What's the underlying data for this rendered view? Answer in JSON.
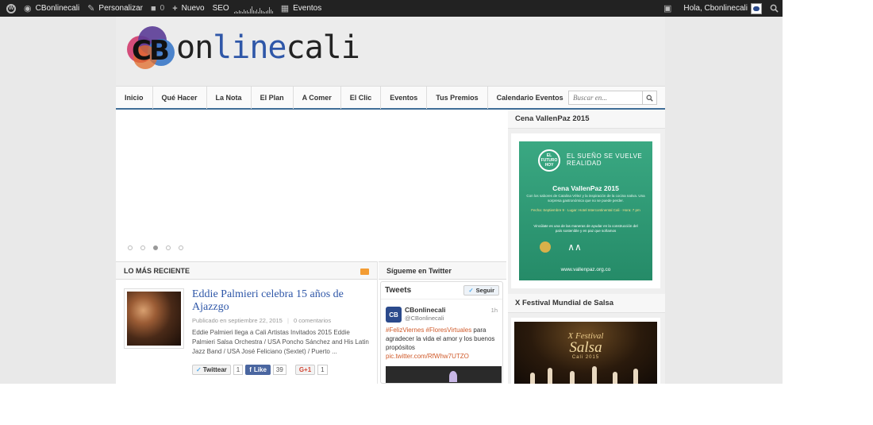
{
  "adminbar": {
    "site_name": "CBonlinecali",
    "customize": "Personalizar",
    "comments_count": "0",
    "new": "Nuevo",
    "seo": "SEO",
    "events": "Eventos",
    "greeting": "Hola, Cbonlinecali"
  },
  "header": {
    "logo_cb": "CB",
    "logo_part1": "on",
    "logo_part2": "line",
    "logo_part3": "cali"
  },
  "nav": {
    "items": [
      "Inicio",
      "Qué Hacer",
      "La Nota",
      "El Plan",
      "A Comer",
      "El Clic",
      "Eventos",
      "Tus Premios",
      "Calendario Eventos"
    ],
    "search_placeholder": "Buscar en..."
  },
  "slider": {
    "dot_count": 5,
    "active_dot": 3
  },
  "recent": {
    "heading": "LO MÁS RECIENTE",
    "post": {
      "title": "Eddie Palmieri celebra 15 años de Ajazzgo",
      "meta_date": "Publicado en septiembre 22, 2015",
      "meta_sep": "|",
      "meta_comments": "0 comentarios",
      "excerpt": "Eddie Palmieri llega a Cali Artistas Invitados 2015 Eddie Palmieri Salsa Orchestra  / USA Poncho Sánchez  and His Latin Jazz Band  / USA José Feliciano (Sextet)  /  Puerto ..."
    },
    "share": {
      "twitter_label": "Twittear",
      "twitter_count": "1",
      "fb_label": "Like",
      "fb_count": "39",
      "gplus_label": "G+1",
      "gplus_count": "1"
    }
  },
  "twitter": {
    "heading": "Sígueme en Twitter",
    "widget_title": "Tweets",
    "follow": "Seguir",
    "avatar_text": "CB",
    "tweet": {
      "name": "CBonlinecali",
      "handle": "@CBonlinecali",
      "time": "1h",
      "hashtags": "#FelizViernes #FloresVirtuales",
      "text": " para agradecer la vida el amor y los buenos propósitos",
      "link": "pic.twitter.com/RfWhw7UTZO"
    }
  },
  "sidebar": {
    "widget1_title": "Cena VallenPaz 2015",
    "ad1": {
      "badge": "EL FUTURO HOY",
      "slogan": "EL SUEÑO SE VUELVE REALIDAD",
      "title": "Cena VallenPaz 2015",
      "subtitle": "Con los sabores de Catalina Vélez y la inspiración de la cocina nativa. Una sorpresa gastronómica que no se puede perder.",
      "details": "Fecha: Septiembre 9 · Lugar: Hotel Intercontinental Cali · Hora: 7 pm",
      "note": "Vincúlate es una de las maneras de ayudar en la construcción del país sostenible y en paz que soñamos",
      "url": "www.vallenpaz.org.co"
    },
    "widget2_title": "X Festival Mundial de Salsa",
    "ad2": {
      "line1": "X Festival",
      "line2": "Salsa",
      "line3": "Cali 2015"
    }
  },
  "colors": {
    "adminbar_bg": "#222222",
    "nav_border": "#3f6d97",
    "link_blue": "#2f57a8",
    "rss_orange": "#f39c33",
    "ad_green": "#3aa882"
  }
}
